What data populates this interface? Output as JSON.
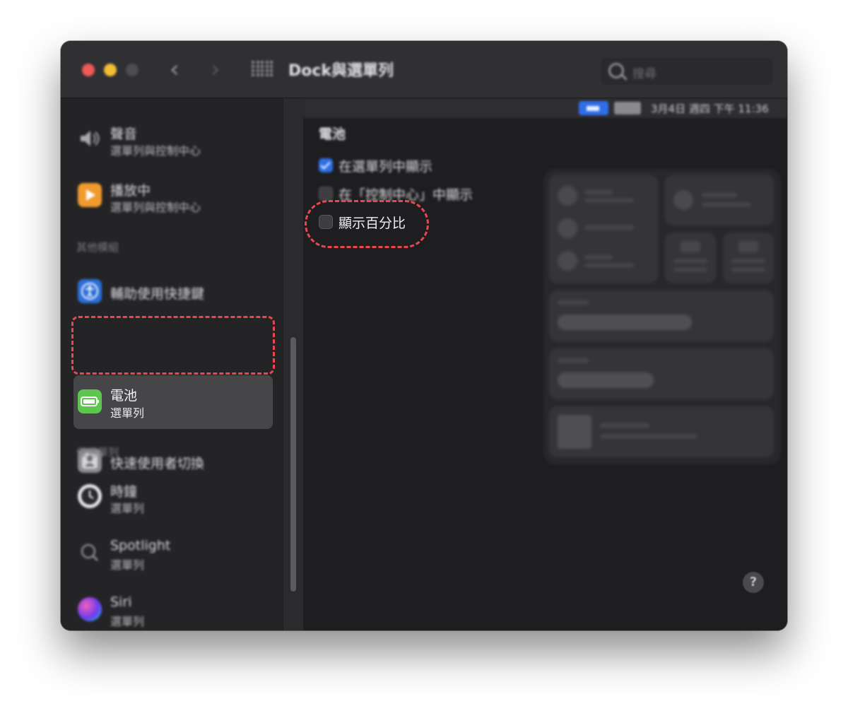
{
  "window": {
    "title": "Dock與選單列"
  },
  "search": {
    "placeholder": "搜尋"
  },
  "colors": {
    "accent": "#2e6fe5",
    "highlight": "#e8474f",
    "battery_icon": "#5ec64f"
  },
  "sidebar": {
    "items_top": [
      {
        "title": "聲音",
        "subtitle": "選單列與控制中心",
        "icon": "speaker-icon"
      },
      {
        "title": "播放中",
        "subtitle": "選單列與控制中心",
        "icon": "play-icon"
      }
    ],
    "section_other": "其他模組",
    "items_other": [
      {
        "title": "輔助使用快捷鍵",
        "icon": "accessibility-icon"
      },
      {
        "title": "電池",
        "subtitle": "選單列",
        "icon": "battery-icon",
        "selected": true
      },
      {
        "title": "快速使用者切換",
        "icon": "user-switch-icon"
      }
    ],
    "section_menubar_only": "僅選單列",
    "items_menubar": [
      {
        "title": "時鐘",
        "subtitle": "選單列",
        "icon": "clock-icon"
      },
      {
        "title": "Spotlight",
        "subtitle": "選單列",
        "icon": "spotlight-icon"
      },
      {
        "title": "Siri",
        "subtitle": "選單列",
        "icon": "siri-icon"
      }
    ]
  },
  "menubar_preview": {
    "datetime": "3月4日 週四 下午 11:36"
  },
  "main": {
    "section_title": "電池",
    "options": [
      {
        "label": "在選單列中顯示",
        "checked": true
      },
      {
        "label": "在「控制中心」中顯示",
        "checked": false
      },
      {
        "label": "顯示百分比",
        "checked": false
      }
    ],
    "help": "?"
  }
}
